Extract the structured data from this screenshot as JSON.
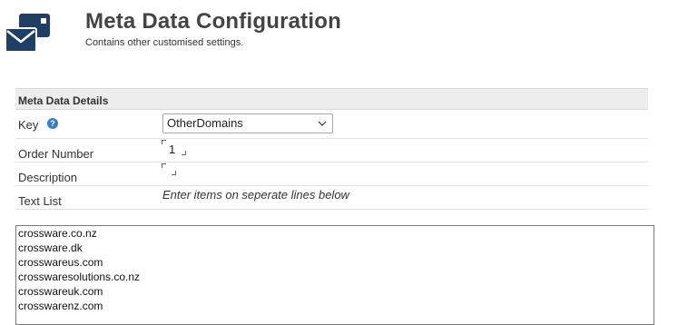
{
  "header": {
    "title": "Meta Data Configuration",
    "subtitle": "Contains other customised settings.",
    "icon": "envelope-card-icon"
  },
  "panel": {
    "title": "Meta Data Details",
    "key": {
      "label": "Key",
      "help_icon": "question-circle-icon",
      "help_glyph": "?",
      "selected": "OtherDomains"
    },
    "order": {
      "label": "Order Number",
      "value": "1"
    },
    "description": {
      "label": "Description",
      "value": ""
    },
    "text_list": {
      "label": "Text List",
      "hint": "Enter items on seperate lines below"
    }
  },
  "text_list_items": [
    "crossware.co.nz",
    "crossware.dk",
    "crosswareus.com",
    "crosswaresolutions.co.nz",
    "crosswareuk.com",
    "crosswarenz.com"
  ],
  "colors": {
    "icon_blue": "#1f3f66",
    "help_blue": "#3a7ec6",
    "panel_header_bg": "#ededed"
  }
}
